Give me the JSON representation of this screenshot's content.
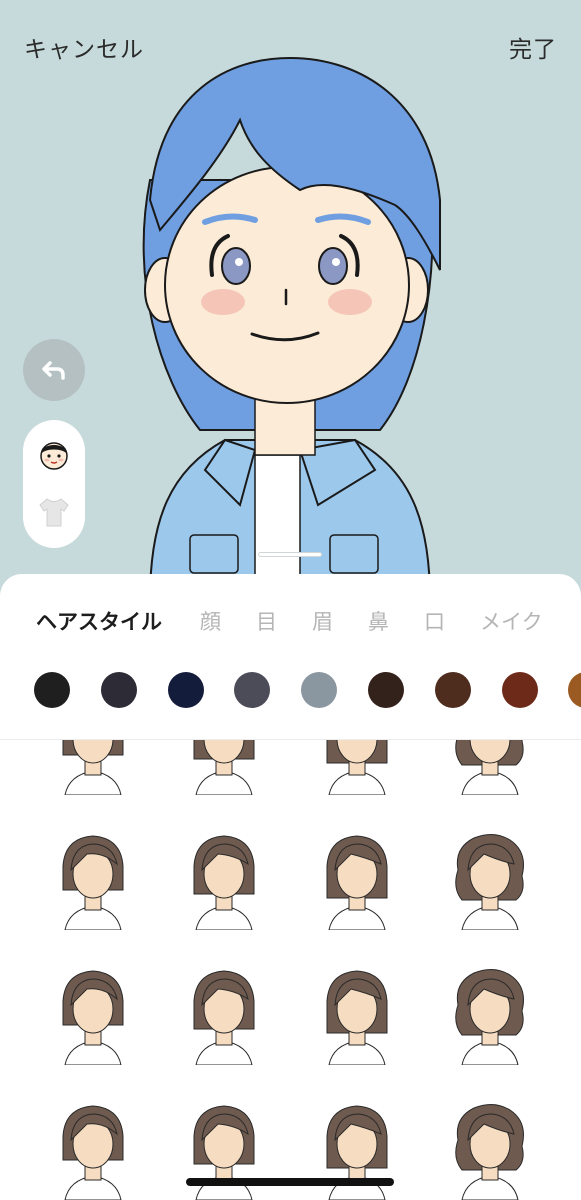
{
  "header": {
    "cancel_label": "キャンセル",
    "done_label": "完了"
  },
  "side_controls": {
    "undo_icon": "undo-arrow-icon",
    "categories": [
      {
        "icon": "face-icon",
        "selected": true
      },
      {
        "icon": "shirt-icon",
        "selected": false
      }
    ]
  },
  "tabs": [
    {
      "label": "ヘアスタイル",
      "active": true
    },
    {
      "label": "顔",
      "active": false
    },
    {
      "label": "目",
      "active": false
    },
    {
      "label": "眉",
      "active": false
    },
    {
      "label": "鼻",
      "active": false
    },
    {
      "label": "口",
      "active": false
    },
    {
      "label": "メイク",
      "active": false
    }
  ],
  "hair_colors": [
    "#1f1f1f",
    "#2c2b36",
    "#141c3b",
    "#4b4c58",
    "#8a96a0",
    "#33211b",
    "#4e2c1e",
    "#6e2a18",
    "#9a5a22"
  ],
  "avatar": {
    "hair_color": "#6f9fe0",
    "skin_color": "#fcebd6",
    "eye_color": "#8c98c4",
    "jacket_color": "#9cc8ec",
    "background_color": "#c7dadb"
  },
  "hairstyle_grid": {
    "hair_color": "#6e5a4e",
    "skin_color": "#f6dcc1",
    "items": [
      {
        "style": "short-back"
      },
      {
        "style": "short-side"
      },
      {
        "style": "short-crop"
      },
      {
        "style": "short-curl"
      },
      {
        "style": "bob-bangs"
      },
      {
        "style": "long-side-part"
      },
      {
        "style": "long-wave"
      },
      {
        "style": "curly-volume"
      },
      {
        "style": "medium-side"
      },
      {
        "style": "long-straight-bangs"
      },
      {
        "style": "wavy-side"
      },
      {
        "style": "curly-medium"
      },
      {
        "style": "long-back"
      },
      {
        "style": "long-side"
      },
      {
        "style": "wavy-long"
      },
      {
        "style": "straight-bangs"
      }
    ]
  }
}
